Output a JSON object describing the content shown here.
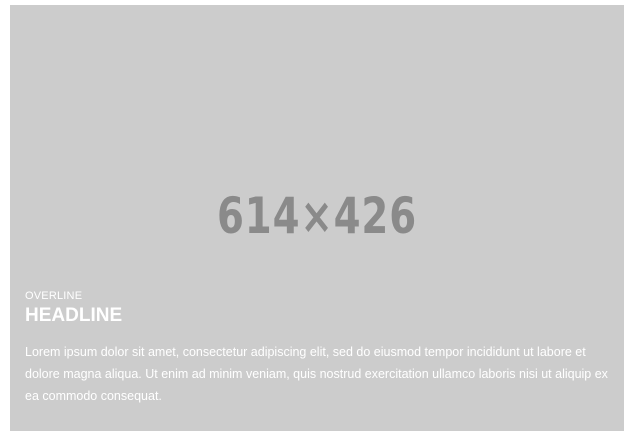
{
  "image_placeholder": {
    "dimensions_label": "614×426"
  },
  "caption": {
    "overline": "OVERLINE",
    "headline": "HEADLINE",
    "body": "Lorem ipsum dolor sit amet, consectetur adipiscing elit, sed do eiusmod tempor incididunt ut labore et dolore magna aliqua. Ut enim ad minim veniam, quis nostrud exercitation ullamco laboris nisi ut aliquip ex ea commodo consequat."
  },
  "colors": {
    "card_background": "#cccccc",
    "placeholder_text": "#8a8a8a",
    "caption_text": "#ffffff"
  }
}
